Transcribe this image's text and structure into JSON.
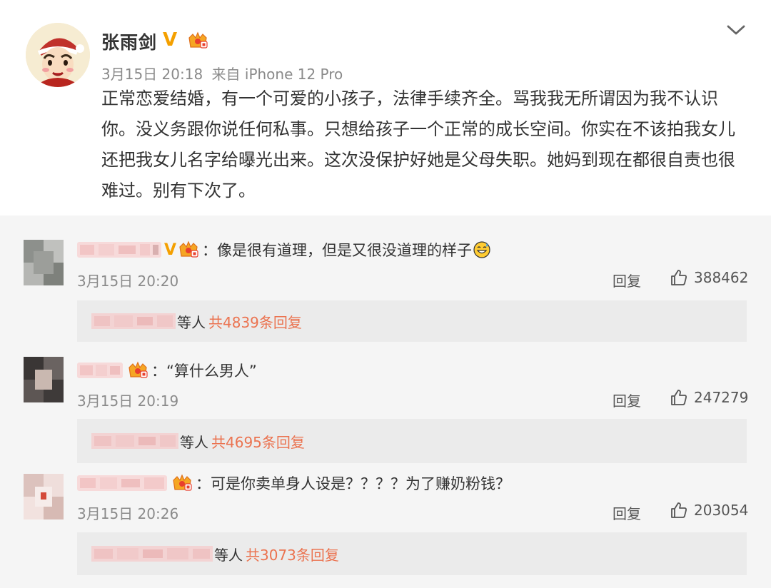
{
  "post": {
    "author": "张雨剑",
    "date": "3月15日 20:18",
    "source": "来自 iPhone 12 Pro",
    "body": "正常恋爱结婚，有一个可爱的小孩子，法律手续齐全。骂我我无所谓因为我不认识你。没义务跟你说任何私事。只想给孩子一个正常的成长空间。你实在不该拍我女儿还把我女儿名字给曝光出来。这次没保护好她是父母失职。她妈到现在都很自责也很难过。别有下次了。",
    "verified_icon": "orange-v-verified-icon",
    "member_icon": "crown-member-icon",
    "collapse_icon": "chevron-down-icon"
  },
  "comments": [
    {
      "text": "：像是很有道理，但是又很没道理的样子",
      "emoji": "sweat-smile-emoji",
      "time": "3月15日 20:20",
      "reply_label": "回复",
      "likes": "388462",
      "sub_etc": "等人",
      "sub_total": "共4839条回复"
    },
    {
      "text": "：“算什么男人”",
      "time": "3月15日 20:19",
      "reply_label": "回复",
      "likes": "247279",
      "sub_etc": "等人",
      "sub_total": "共4695条回复"
    },
    {
      "text": "：可是你卖单身人设是？？？？为了赚奶粉钱？",
      "time": "3月15日 20:26",
      "reply_label": "回复",
      "likes": "203054",
      "sub_etc": "等人",
      "sub_total": "共3073条回复"
    }
  ],
  "colors": {
    "accent_link": "#eb7350",
    "verified_orange": "#f4a000",
    "meta_gray": "#8a8a8a",
    "comment_bg": "#f5f5f5",
    "subreply_bg": "#ebebeb"
  }
}
